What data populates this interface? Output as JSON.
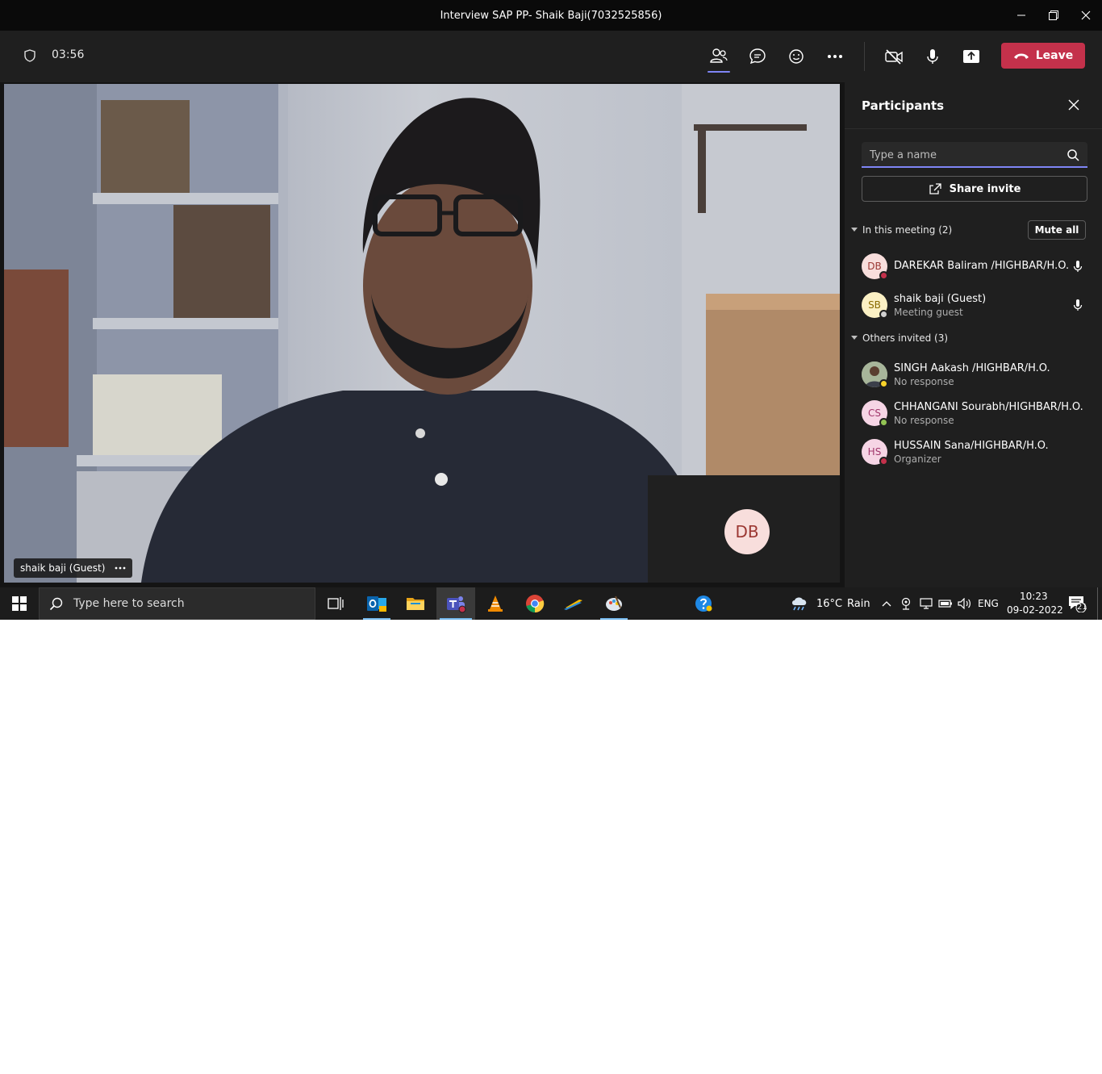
{
  "window": {
    "title": "Interview SAP PP- Shaik Baji(7032525856)"
  },
  "toolbar": {
    "timer": "03:56",
    "leave_label": "Leave"
  },
  "stage": {
    "video_name": "shaik baji (Guest)",
    "self_initials": "DB"
  },
  "panel": {
    "title": "Participants",
    "search_placeholder": "Type a name",
    "share_label": "Share invite",
    "in_meeting_label": "In this meeting (2)",
    "mute_all_label": "Mute all",
    "in_meeting": [
      {
        "initials": "DB",
        "name": "DAREKAR Baliram /HIGHBAR/H.O.",
        "sub": "",
        "avatar_bg": "#f8dedc",
        "avatar_fg": "#9c3833",
        "status": "#c4314b"
      },
      {
        "initials": "SB",
        "name": "shaik baji (Guest)",
        "sub": "Meeting guest",
        "avatar_bg": "#fbf0c4",
        "avatar_fg": "#8a6b00",
        "status": "#d0d0d0"
      }
    ],
    "others_label": "Others invited (3)",
    "others": [
      {
        "initials": "",
        "name": "SINGH Aakash /HIGHBAR/H.O.",
        "sub": "No response",
        "avatar_bg": "#8a9a7a",
        "avatar_fg": "#ffffff",
        "status": "#f8d22a"
      },
      {
        "initials": "CS",
        "name": "CHHANGANI Sourabh/HIGHBAR/H.O.",
        "sub": "No response",
        "avatar_bg": "#f6d5e5",
        "avatar_fg": "#a0366b",
        "status": "#92c353"
      },
      {
        "initials": "HS",
        "name": "HUSSAIN Sana/HIGHBAR/H.O.",
        "sub": "Organizer",
        "avatar_bg": "#f6d5e5",
        "avatar_fg": "#a0366b",
        "status": "#c4314b"
      }
    ]
  },
  "taskbar": {
    "search_placeholder": "Type here to search",
    "weather_temp": "16°C",
    "weather_text": "Rain",
    "language": "ENG",
    "time": "10:23",
    "date": "09-02-2022",
    "notifications_count": "21"
  },
  "colors": {
    "accent": "#7f85f5",
    "leave": "#c4314b",
    "panel_bg": "#1f1f1f"
  }
}
